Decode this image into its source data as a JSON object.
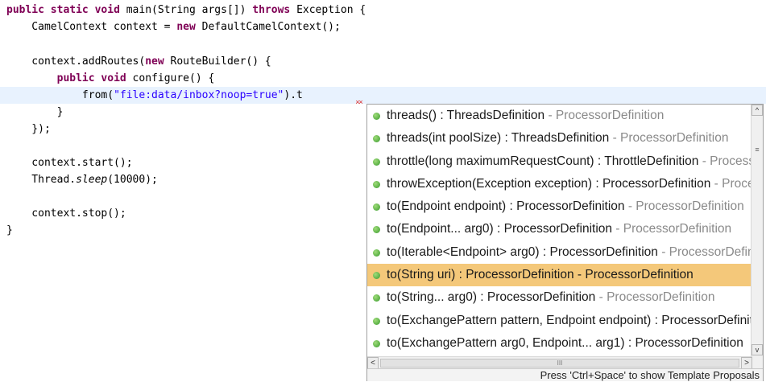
{
  "editor": {
    "keywords": {
      "public": "public",
      "static": "static",
      "void": "void",
      "throws": "throws",
      "new": "new"
    },
    "line1": {
      "main_sig": " main(String args[]) ",
      "exception": " Exception {"
    },
    "line2": {
      "a": "    CamelContext context = ",
      "b": " DefaultCamelContext();"
    },
    "line4": {
      "a": "    context.addRoutes(",
      "b": " RouteBuilder() {"
    },
    "line5": {
      "indent": "        ",
      "b": " configure() {"
    },
    "line6": {
      "a": "            from(",
      "str": "\"file:data/inbox?noop=true\"",
      "b": ").t"
    },
    "line7": "        }",
    "line8": "    });",
    "line10": "    context.start();",
    "line11": {
      "a": "    Thread.",
      "it": "sleep",
      "b": "(10000);"
    },
    "line13": "    context.stop();",
    "line14": "}"
  },
  "autocomplete": {
    "items": [
      {
        "main": "threads() : ThreadsDefinition",
        "sec": " - ProcessorDefinition"
      },
      {
        "main": "threads(int poolSize) : ThreadsDefinition",
        "sec": " - ProcessorDefinition"
      },
      {
        "main": "throttle(long maximumRequestCount) : ThrottleDefinition",
        "sec": " - ProcessorDefinition"
      },
      {
        "main": "throwException(Exception exception) : ProcessorDefinition",
        "sec": " - ProcessorDefinition"
      },
      {
        "main": "to(Endpoint endpoint) : ProcessorDefinition",
        "sec": " - ProcessorDefinition"
      },
      {
        "main": "to(Endpoint... arg0) : ProcessorDefinition",
        "sec": " - ProcessorDefinition"
      },
      {
        "main": "to(Iterable<Endpoint> arg0) : ProcessorDefinition",
        "sec": " - ProcessorDefinition"
      },
      {
        "main": "to(String uri) : ProcessorDefinition - ProcessorDefinition",
        "sec": ""
      },
      {
        "main": "to(String... arg0) : ProcessorDefinition",
        "sec": " - ProcessorDefinition"
      },
      {
        "main": "to(ExchangePattern pattern, Endpoint endpoint) : ProcessorDefinition",
        "sec": ""
      },
      {
        "main": "to(ExchangePattern arg0, Endpoint... arg1) : ProcessorDefinition",
        "sec": ""
      }
    ],
    "selected_index": 7,
    "scrollbar": {
      "up_arrow": "^",
      "down_arrow": "v",
      "left_arrow": "<",
      "right_arrow": ">",
      "thumb_grip": "III"
    },
    "status_text": "Press 'Ctrl+Space' to show Template Proposals"
  }
}
